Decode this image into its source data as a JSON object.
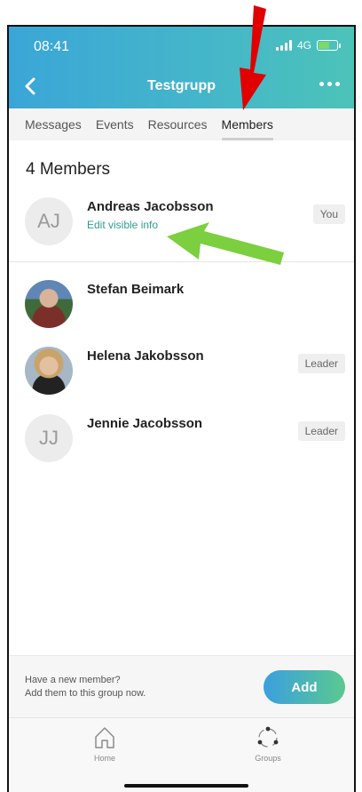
{
  "status": {
    "time": "08:41",
    "network": "4G"
  },
  "header": {
    "title": "Testgrupp"
  },
  "tabs": [
    {
      "label": "Messages"
    },
    {
      "label": "Events"
    },
    {
      "label": "Resources"
    },
    {
      "label": "Members",
      "active": true
    }
  ],
  "members": {
    "title": "4 Members",
    "list": [
      {
        "initials": "AJ",
        "name": "Andreas Jacobsson",
        "sub": "Edit visible info",
        "badge": "You"
      },
      {
        "initials": "",
        "name": "Stefan Beimark",
        "sub": "",
        "badge": ""
      },
      {
        "initials": "",
        "name": "Helena Jakobsson",
        "sub": "",
        "badge": "Leader"
      },
      {
        "initials": "JJ",
        "name": "Jennie Jacobsson",
        "sub": "",
        "badge": "Leader"
      }
    ]
  },
  "invite": {
    "line1": "Have a new member?",
    "line2": "Add them to this group now.",
    "button": "Add"
  },
  "nav": [
    {
      "label": "Home"
    },
    {
      "label": "Groups"
    }
  ],
  "colors": {
    "header_start": "#3aa6d8",
    "header_end": "#4cc3b9",
    "accent_link": "#2f9d8d",
    "annotation_red": "#e10000",
    "annotation_green": "#7ccf3e"
  }
}
